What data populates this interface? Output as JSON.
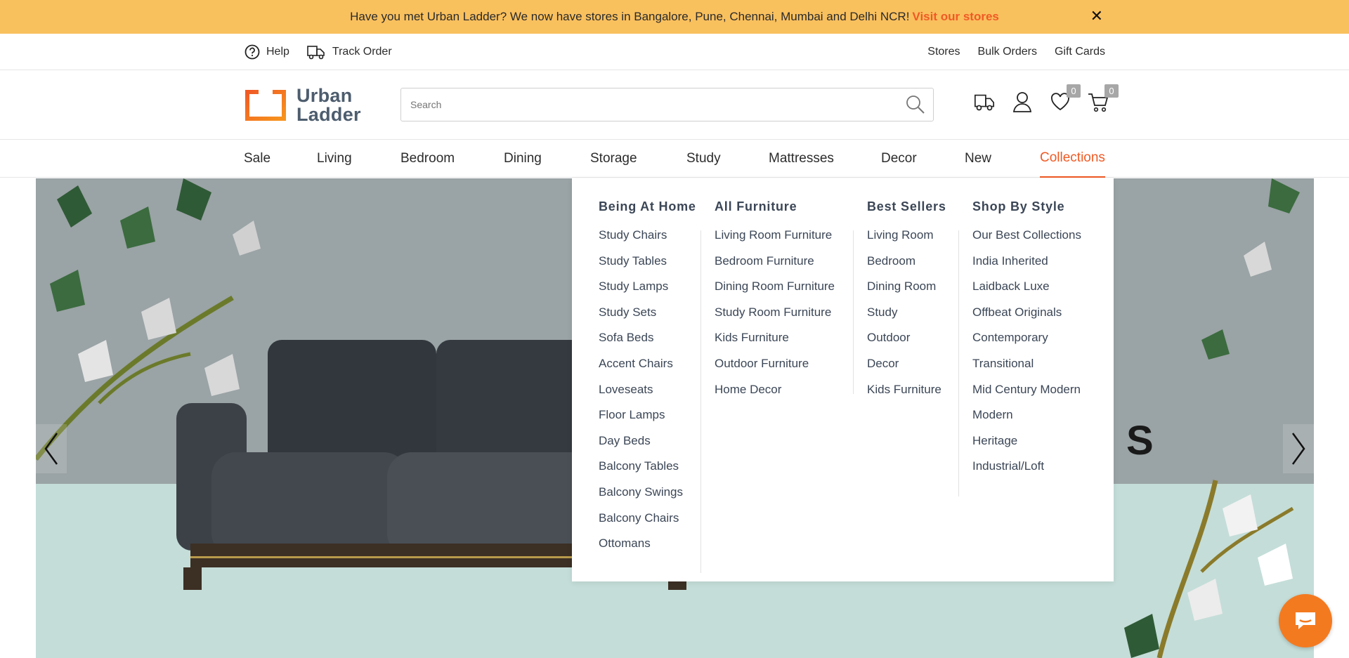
{
  "announcement": {
    "text": "Have you met Urban Ladder? We now have stores in Bangalore, Pune, Chennai, Mumbai and Delhi NCR!",
    "link": "Visit our stores",
    "close": "✕"
  },
  "utility": {
    "help": "Help",
    "track_order": "Track Order",
    "stores": "Stores",
    "bulk_orders": "Bulk Orders",
    "gift_cards": "Gift Cards"
  },
  "header": {
    "logo_line1": "Urban",
    "logo_line2": "Ladder",
    "search_placeholder": "Search",
    "wishlist_count": "0",
    "cart_count": "0"
  },
  "nav": {
    "items": [
      "Sale",
      "Living",
      "Bedroom",
      "Dining",
      "Storage",
      "Study",
      "Mattresses",
      "Decor",
      "New",
      "Collections"
    ],
    "active": "Collections"
  },
  "mega_menu": {
    "columns": [
      {
        "heading": "Being At Home",
        "items": [
          "Study Chairs",
          "Study Tables",
          "Study Lamps",
          "Study Sets",
          "Sofa Beds",
          "Accent Chairs",
          "Loveseats",
          "Floor Lamps",
          "Day Beds",
          "Balcony Tables",
          "Balcony Swings",
          "Balcony Chairs",
          "Ottomans"
        ]
      },
      {
        "heading": "All Furniture",
        "items": [
          "Living Room Furniture",
          "Bedroom Furniture",
          "Dining Room Furniture",
          "Study Room Furniture",
          "Kids Furniture",
          "Outdoor Furniture",
          "Home Decor"
        ]
      },
      {
        "heading": "Best Sellers",
        "items": [
          "Living Room",
          "Bedroom",
          "Dining Room",
          "Study",
          "Outdoor",
          "Decor",
          "Kids Furniture"
        ]
      },
      {
        "heading": "Shop By Style",
        "items": [
          "Our Best Collections",
          "India Inherited",
          "Laidback Luxe",
          "Offbeat Originals",
          "Contemporary",
          "Transitional",
          "Mid Century Modern",
          "Modern",
          "Heritage",
          "Industrial/Loft"
        ]
      }
    ]
  },
  "hero": {
    "partial_text": "S"
  },
  "colors": {
    "accent": "#f05a24",
    "announce_bg": "#f9c05e",
    "menu_text": "#3b4656"
  }
}
